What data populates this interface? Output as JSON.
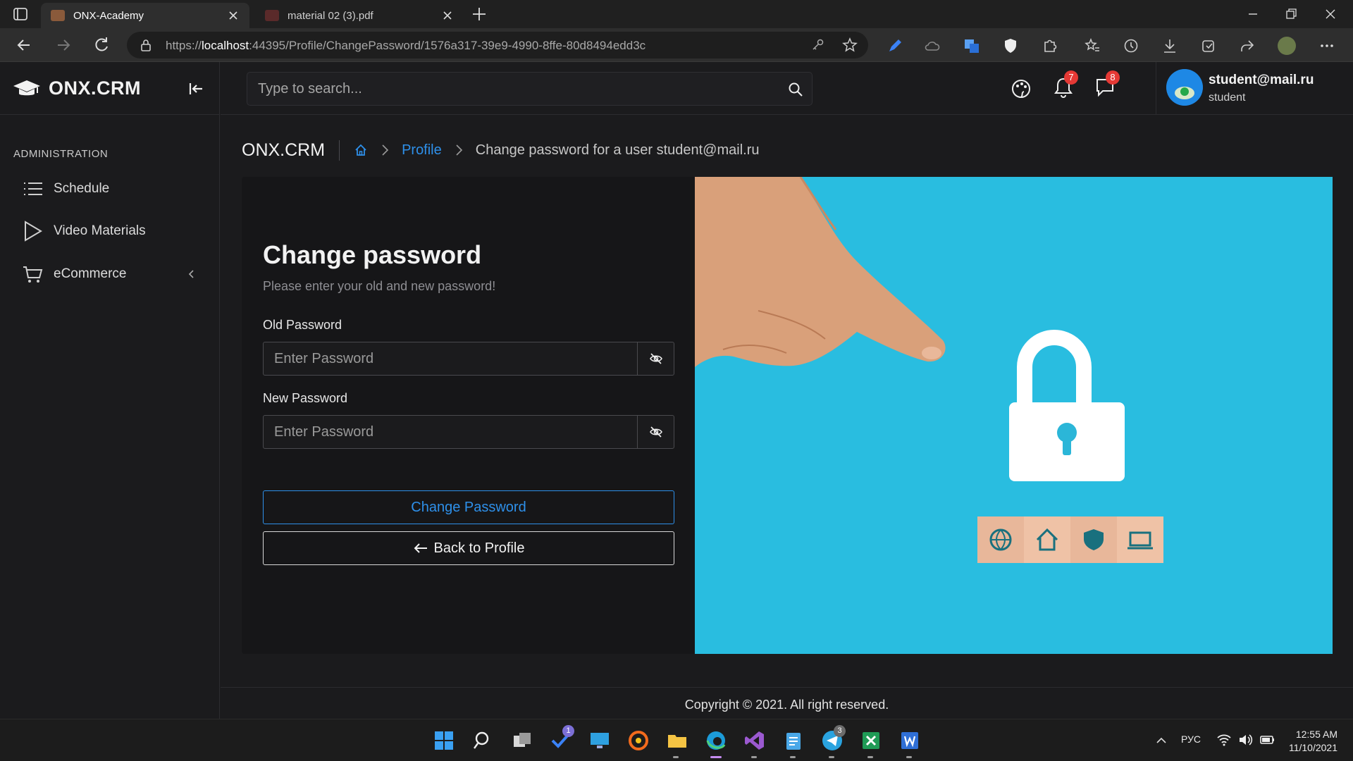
{
  "browser": {
    "tabs": [
      {
        "title": "ONX-Academy",
        "active": true
      },
      {
        "title": "material 02 (3).pdf",
        "active": false
      }
    ],
    "url_prefix": "https://",
    "url_host": "localhost",
    "url_rest": ":44395/Profile/ChangePassword/1576a317-39e9-4990-8ffe-80d8494edd3c"
  },
  "app": {
    "brand": "ONX.CRM",
    "section_title": "ADMINISTRATION",
    "nav": [
      {
        "label": "Schedule",
        "icon": "list-icon"
      },
      {
        "label": "Video Materials",
        "icon": "play-icon"
      },
      {
        "label": "eCommerce",
        "icon": "cart-icon"
      }
    ],
    "search_placeholder": "Type to search...",
    "notifications_count": "7",
    "messages_count": "8",
    "user": {
      "email": "student@mail.ru",
      "role": "student"
    }
  },
  "breadcrumb": {
    "app": "ONX.CRM",
    "profile": "Profile",
    "current": "Change password for a user student@mail.ru"
  },
  "form": {
    "title": "Change password",
    "subtitle": "Please enter your old and new password!",
    "old_label": "Old Password",
    "old_placeholder": "Enter Password",
    "new_label": "New Password",
    "new_placeholder": "Enter Password",
    "submit": "Change Password",
    "back": "Back to Profile"
  },
  "footer": "Copyright © 2021. All right reserved.",
  "taskbar": {
    "todo_badge": "1",
    "telegram_badge": "3",
    "lang": "РУС",
    "time": "12:55 AM",
    "date": "11/10/2021"
  },
  "colors": {
    "accent": "#2e90ea",
    "hero_bg": "#29bde0",
    "badge": "#e53935"
  }
}
